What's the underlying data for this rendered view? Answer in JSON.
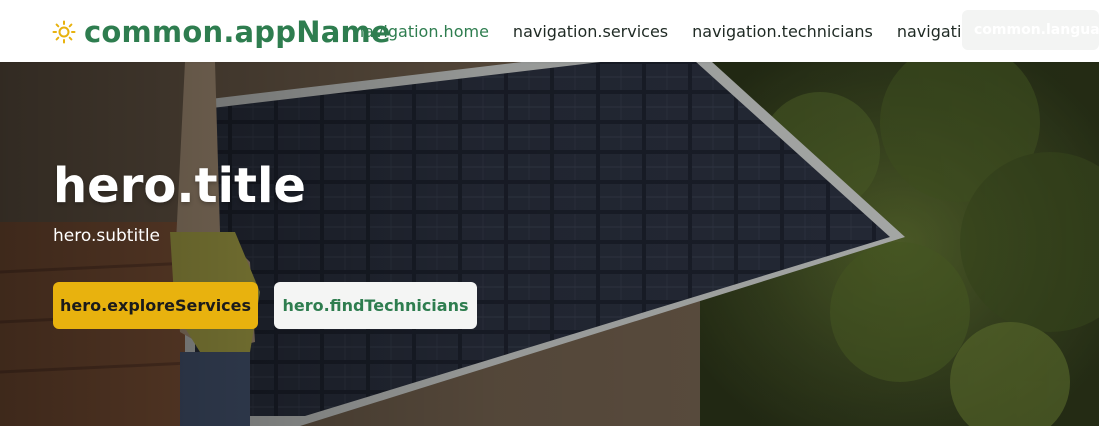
{
  "header": {
    "app_name": "common.appName",
    "logo_icon": "sun-icon",
    "nav": [
      {
        "label": "navigation.home",
        "active": true
      },
      {
        "label": "navigation.services",
        "active": false
      },
      {
        "label": "navigation.technicians",
        "active": false
      },
      {
        "label": "navigation.contact",
        "active": false
      }
    ],
    "language_label": "common.language"
  },
  "hero": {
    "title": "hero.title",
    "subtitle": "hero.subtitle",
    "primary_button": "hero.exploreServices",
    "secondary_button": "hero.findTechnicians",
    "background": "photo of person holding a solar panel outdoors"
  },
  "colors": {
    "brand_green": "#2e7d4f",
    "accent_yellow": "#e8b20e",
    "logo_sun": "#e8b20e"
  }
}
